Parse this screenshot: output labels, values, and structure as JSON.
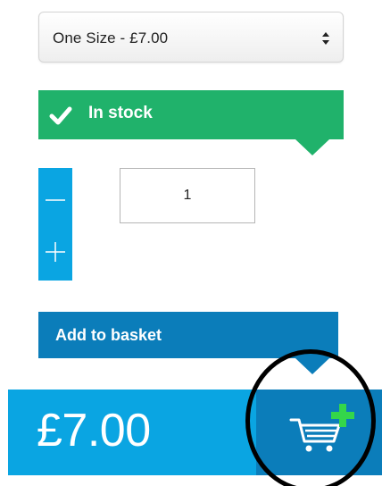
{
  "product_form": {
    "size_select": {
      "selected": "One Size - £7.00"
    },
    "stock": {
      "status": "In stock",
      "color": "#20b26b"
    },
    "quantity": {
      "value": "1"
    },
    "add_to_basket": {
      "label": "Add to basket",
      "color": "#0b7dba"
    }
  },
  "price_bar": {
    "price": "£7.00",
    "color": "#0aa5e2"
  },
  "icons": {
    "check": "check-icon",
    "minus": "minus-icon",
    "plus": "plus-icon",
    "cart": "cart-add-icon",
    "select_arrows": "select-arrows-icon"
  }
}
